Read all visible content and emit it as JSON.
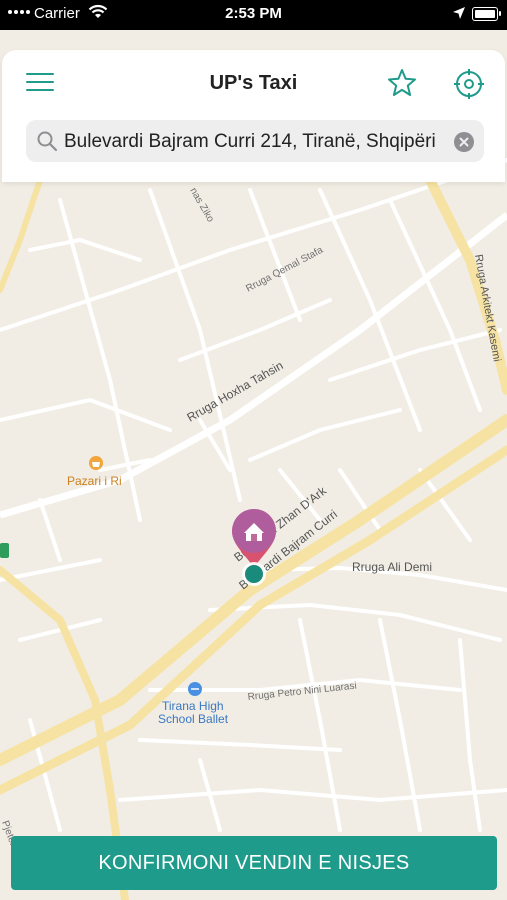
{
  "status_bar": {
    "carrier": "Carrier",
    "time": "2:53 PM"
  },
  "header": {
    "title": "UP's Taxi"
  },
  "search": {
    "value": "Bulevardi Bajram Curri 214, Tiranë, Shqipëri"
  },
  "map": {
    "streets": {
      "rruga_qemal_stafa": "Rruga Qemal Stafa",
      "rruga_arkitekt_kasemi": "Rruga Arkitekt Kasemi",
      "rruga_hoxha_tahsin": "Rruga Hoxha Tahsin",
      "bulevardi_zhan_dark": "Bulevardi Zhan D'Ark",
      "bulevardi_bajram_curri": "Bulevardi Bajram Curri",
      "rruga_ali_demi": "Rruga Ali Demi",
      "rruga_petro_nini_luarasi": "Rruga Petro Nini Luarasi",
      "rruga_ziko": "nas Ziko",
      "rruga_gjomarku": "Pjeter Gjomark"
    },
    "pois": {
      "pazari_i_ri": "Pazari i Ri",
      "tirana_high_school_ballet_line1": "Tirana High",
      "tirana_high_school_ballet_line2": "School Ballet"
    }
  },
  "confirm_button": {
    "label": "KONFIRMONI VENDIN E NISJES"
  },
  "colors": {
    "accent": "#1f9b8b",
    "pin": "#d9536f",
    "map_bg": "#f1ede4",
    "major_road": "#f6e3a3"
  }
}
